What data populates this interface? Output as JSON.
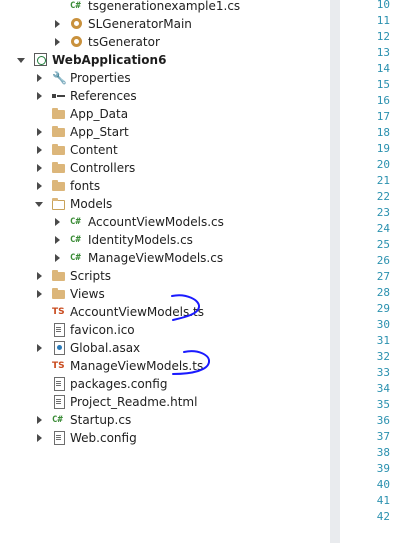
{
  "solution_explorer": {
    "items": [
      {
        "label": "tsgenerationexample1.cs",
        "icon": "csharp-file-icon",
        "bold": false,
        "expander": "none"
      },
      {
        "label": "SLGeneratorMain",
        "icon": "class-gear-icon",
        "bold": false,
        "expander": "collapsed"
      },
      {
        "label": "tsGenerator",
        "icon": "class-gear-icon",
        "bold": false,
        "expander": "collapsed"
      },
      {
        "label": "WebApplication6",
        "icon": "web-project-icon",
        "bold": true,
        "expander": "expanded"
      },
      {
        "label": "Properties",
        "icon": "wrench-icon",
        "bold": false,
        "expander": "collapsed"
      },
      {
        "label": "References",
        "icon": "references-icon",
        "bold": false,
        "expander": "collapsed"
      },
      {
        "label": "App_Data",
        "icon": "folder-icon",
        "bold": false,
        "expander": "none"
      },
      {
        "label": "App_Start",
        "icon": "folder-icon",
        "bold": false,
        "expander": "collapsed"
      },
      {
        "label": "Content",
        "icon": "folder-icon",
        "bold": false,
        "expander": "collapsed"
      },
      {
        "label": "Controllers",
        "icon": "folder-icon",
        "bold": false,
        "expander": "collapsed"
      },
      {
        "label": "fonts",
        "icon": "folder-icon",
        "bold": false,
        "expander": "collapsed"
      },
      {
        "label": "Models",
        "icon": "folder-open-icon",
        "bold": false,
        "expander": "expanded"
      },
      {
        "label": "AccountViewModels.cs",
        "icon": "csharp-file-icon",
        "bold": false,
        "expander": "collapsed"
      },
      {
        "label": "IdentityModels.cs",
        "icon": "csharp-file-icon",
        "bold": false,
        "expander": "collapsed"
      },
      {
        "label": "ManageViewModels.cs",
        "icon": "csharp-file-icon",
        "bold": false,
        "expander": "collapsed"
      },
      {
        "label": "Scripts",
        "icon": "folder-icon",
        "bold": false,
        "expander": "collapsed"
      },
      {
        "label": "Views",
        "icon": "folder-icon",
        "bold": false,
        "expander": "collapsed"
      },
      {
        "label": "AccountViewModels.ts",
        "icon": "typescript-file-icon",
        "bold": false,
        "expander": "none"
      },
      {
        "label": "favicon.ico",
        "icon": "image-file-icon",
        "bold": false,
        "expander": "none"
      },
      {
        "label": "Global.asax",
        "icon": "globe-file-icon",
        "bold": false,
        "expander": "collapsed"
      },
      {
        "label": "ManageViewModels.ts",
        "icon": "typescript-file-icon",
        "bold": false,
        "expander": "none"
      },
      {
        "label": "packages.config",
        "icon": "config-file-icon",
        "bold": false,
        "expander": "none"
      },
      {
        "label": "Project_Readme.html",
        "icon": "html-file-icon",
        "bold": false,
        "expander": "none"
      },
      {
        "label": "Startup.cs",
        "icon": "csharp-file-icon",
        "bold": false,
        "expander": "collapsed"
      },
      {
        "label": "Web.config",
        "icon": "config-file-icon",
        "bold": false,
        "expander": "collapsed"
      }
    ],
    "icon_glyphs": {
      "csharp": "C#",
      "typescript": "TS",
      "wrench": "🔧"
    }
  },
  "editor": {
    "line_numbers": [
      "10",
      "11",
      "12",
      "13",
      "14",
      "15",
      "16",
      "17",
      "18",
      "19",
      "20",
      "21",
      "22",
      "23",
      "24",
      "25",
      "26",
      "27",
      "28",
      "29",
      "30",
      "31",
      "32",
      "33",
      "34",
      "35",
      "36",
      "37",
      "38",
      "39",
      "40",
      "41",
      "42"
    ]
  },
  "colors": {
    "line_number": "#2b91af",
    "csharp_icon": "#388a34",
    "typescript_icon": "#c94b1e",
    "folder": "#dcb67a",
    "annotation_pen": "#1a1aff"
  }
}
